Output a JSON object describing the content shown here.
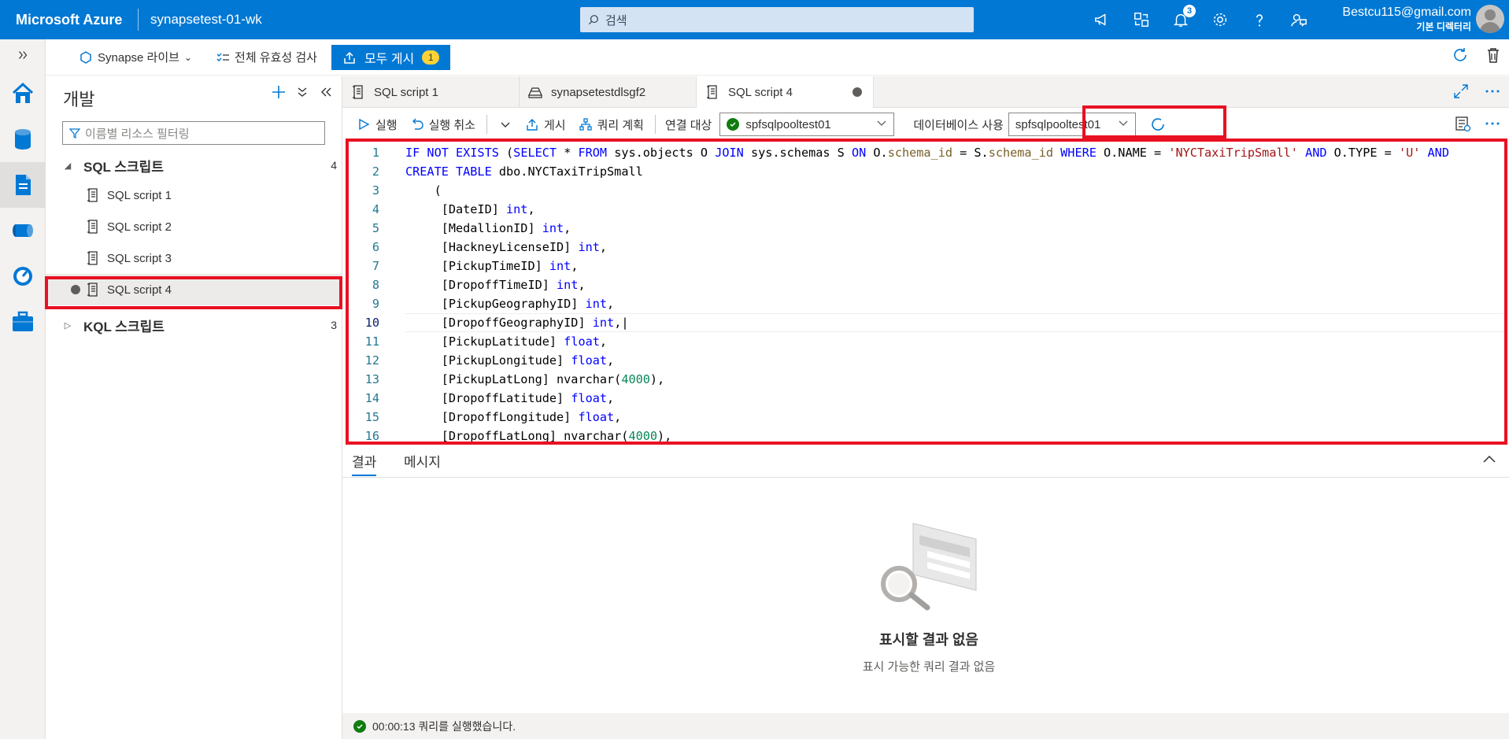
{
  "header": {
    "brand": "Microsoft Azure",
    "workspace": "synapsetest-01-wk",
    "search_placeholder": "검색",
    "notification_count": "3",
    "account_email": "Bestcu115@gmail.com",
    "account_directory": "기본 디렉터리"
  },
  "commandbar": {
    "synapse_live": "Synapse 라이브",
    "validate_all": "전체 유효성 검사",
    "publish_all": "모두 게시",
    "publish_count": "1"
  },
  "panel": {
    "title": "개발",
    "filter_placeholder": "이름별 리소스 필터링",
    "groups": [
      {
        "label": "SQL 스크립트",
        "count": "4"
      },
      {
        "label": "KQL 스크립트",
        "count": "3"
      }
    ],
    "sql_items": [
      "SQL script 1",
      "SQL script 2",
      "SQL script 3",
      "SQL script 4"
    ]
  },
  "tabs": [
    "SQL script 1",
    "synapsetestdlsgf2",
    "SQL script 4"
  ],
  "toolbar": {
    "run": "실행",
    "cancel": "실행 취소",
    "publish": "게시",
    "query_plan": "쿼리 계획",
    "connect_label": "연결 대상",
    "connect_value": "spfsqlpooltest01",
    "use_db_label": "데이터베이스 사용",
    "use_db_value": "spfsqlpooltest01"
  },
  "editor": {
    "line_numbers": [
      "1",
      "2",
      "3",
      "4",
      "5",
      "6",
      "7",
      "8",
      "9",
      "10",
      "11",
      "12",
      "13",
      "14",
      "15",
      "16"
    ]
  },
  "results": {
    "tab_results": "결과",
    "tab_messages": "메시지",
    "empty_title": "표시할 결과 없음",
    "empty_subtitle": "표시 가능한 쿼리 결과 없음"
  },
  "status": {
    "text": "00:00:13 쿼리를 실행했습니다."
  },
  "colors": {
    "azure_blue": "#0078d4",
    "highlight_red": "#e81123",
    "keyword_blue": "#0000ff",
    "string_red": "#a31515",
    "number_green": "#098658",
    "success_green": "#107c10"
  }
}
